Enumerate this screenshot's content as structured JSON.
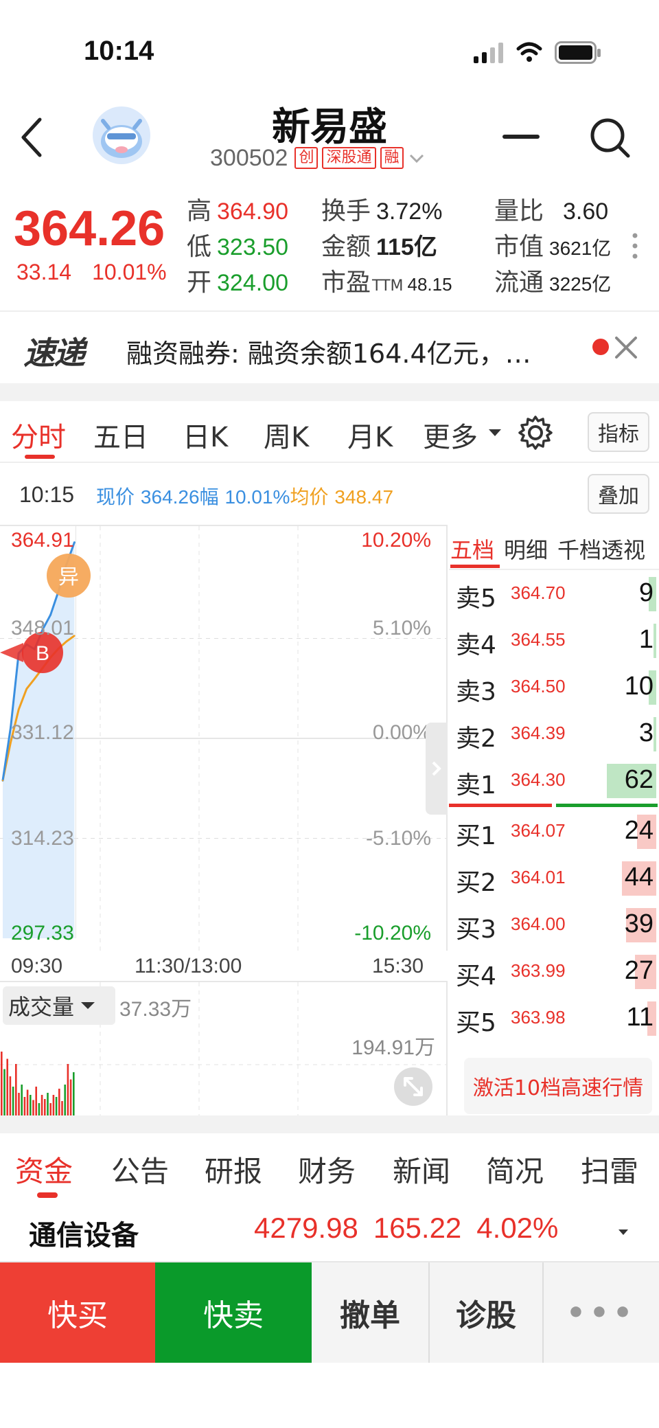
{
  "status_bar": {
    "time": "10:14"
  },
  "header": {
    "stock_name": "新易盛",
    "stock_code": "300502",
    "tags": [
      "创",
      "深股通",
      "融"
    ]
  },
  "quote": {
    "price": "364.26",
    "change": "33.14",
    "change_pct": "10.01%",
    "fields": {
      "high": {
        "label": "高",
        "value": "364.90"
      },
      "low": {
        "label": "低",
        "value": "323.50"
      },
      "open": {
        "label": "开",
        "value": "324.00"
      },
      "turnover_rate": {
        "label": "换手",
        "value": "3.72%"
      },
      "amount": {
        "label": "金额",
        "value": "115亿"
      },
      "pe": {
        "label": "市盈",
        "sub": "TTM",
        "value": "48.15"
      },
      "volume_ratio": {
        "label": "量比",
        "value": "3.60"
      },
      "market_cap": {
        "label": "市值",
        "value": "3621亿"
      },
      "float_cap": {
        "label": "流通",
        "value": "3225亿"
      }
    }
  },
  "news": {
    "logo": "速递",
    "text": "融资融券: 融资余额164.4亿元，…"
  },
  "chart_tabs": {
    "items": [
      "分时",
      "五日",
      "日K",
      "周K",
      "月K",
      "更多"
    ],
    "active": "分时",
    "indicator_button": "指标",
    "overlay_button": "叠加"
  },
  "info_line": {
    "time": "10:15",
    "price_label": "现价",
    "price": "364.26",
    "range_label": "幅",
    "range": "10.01%",
    "avg_label": "均价",
    "avg": "348.47"
  },
  "chart_data": {
    "type": "line",
    "y_left_labels": [
      "364.91",
      "348.01",
      "331.12",
      "314.23",
      "297.33"
    ],
    "y_right_labels": [
      "10.20%",
      "5.10%",
      "0.00%",
      "-5.10%",
      "-10.20%"
    ],
    "x_labels": [
      "09:30",
      "11:30/13:00",
      "15:30"
    ],
    "ylim": [
      297.33,
      364.91
    ],
    "series": [
      {
        "x": [
          "09:30",
          "09:31",
          "09:32",
          "09:34",
          "09:36",
          "09:38",
          "09:40",
          "09:42",
          "09:44",
          "09:45"
        ],
        "values": [
          324.0,
          333.0,
          345.5,
          347.0,
          346.2,
          349.5,
          352.0,
          356.0,
          360.5,
          364.26
        ]
      },
      {
        "x": [
          "09:30",
          "09:31",
          "09:32",
          "09:34",
          "09:36",
          "09:38",
          "09:40",
          "09:42",
          "09:44",
          "09:45"
        ],
        "values": [
          324.0,
          330.5,
          336.0,
          339.5,
          341.2,
          343.0,
          344.8,
          346.3,
          347.5,
          348.47
        ]
      }
    ],
    "markers": [
      "异",
      "B"
    ],
    "colors": {
      "price": "#3a8fe0",
      "avg": "#f0a020",
      "fill": "#d8eafb"
    }
  },
  "volume": {
    "label": "成交量",
    "current": "37.33万",
    "max": "194.91万",
    "bars": [
      0.62,
      0.45,
      0.55,
      0.38,
      0.28,
      0.5,
      0.22,
      0.3,
      0.18,
      0.25,
      0.2,
      0.15,
      0.28,
      0.12,
      0.2,
      0.16,
      0.22,
      0.12,
      0.2,
      0.18,
      0.26,
      0.14,
      0.3,
      0.5,
      0.35,
      0.42
    ]
  },
  "order_book": {
    "tabs": [
      "五档",
      "明细",
      "千档透视"
    ],
    "active_tab": "五档",
    "asks": [
      {
        "label": "卖5",
        "price": "364.70",
        "vol": "9",
        "fill": 0.1
      },
      {
        "label": "卖4",
        "price": "364.55",
        "vol": "1",
        "fill": 0.02
      },
      {
        "label": "卖3",
        "price": "364.50",
        "vol": "10",
        "fill": 0.1
      },
      {
        "label": "卖2",
        "price": "364.39",
        "vol": "3",
        "fill": 0.04
      },
      {
        "label": "卖1",
        "price": "364.30",
        "vol": "62",
        "fill": 0.65
      }
    ],
    "bids": [
      {
        "label": "买1",
        "price": "364.07",
        "vol": "24",
        "fill": 0.25
      },
      {
        "label": "买2",
        "price": "364.01",
        "vol": "44",
        "fill": 0.45
      },
      {
        "label": "买3",
        "price": "364.00",
        "vol": "39",
        "fill": 0.4
      },
      {
        "label": "买4",
        "price": "363.99",
        "vol": "27",
        "fill": 0.28
      },
      {
        "label": "买5",
        "price": "363.98",
        "vol": "11",
        "fill": 0.12
      }
    ],
    "activate_label": "激活10档高速行情"
  },
  "bottom_tabs": {
    "items": [
      "资金",
      "公告",
      "研报",
      "财务",
      "新闻",
      "简况",
      "扫雷"
    ],
    "active": "资金"
  },
  "sector": {
    "name": "通信设备",
    "index": "4279.98",
    "change": "165.22",
    "change_pct": "4.02%"
  },
  "actions": {
    "quick_buy": "快买",
    "quick_sell": "快卖",
    "cancel": "撤单",
    "diagnose": "诊股",
    "more": "•••"
  }
}
